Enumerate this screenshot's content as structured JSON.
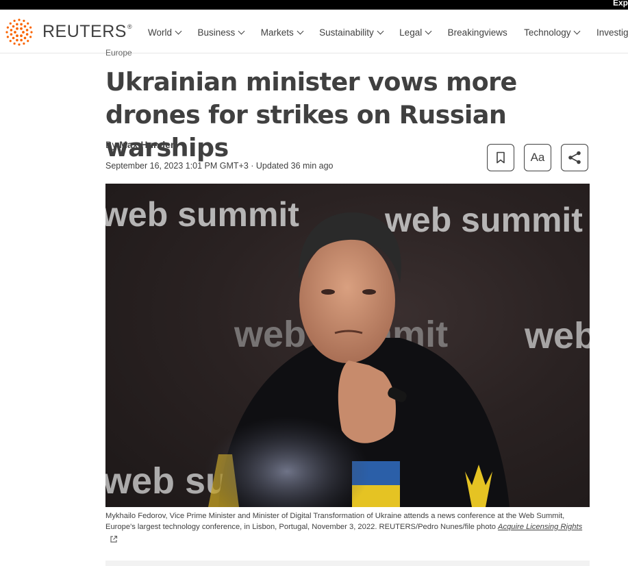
{
  "topbar": {
    "corner_text": "Exp"
  },
  "brand": {
    "name": "REUTERS",
    "mark": "®",
    "color": "#fa6400"
  },
  "nav": {
    "items": [
      {
        "label": "World",
        "dropdown": true
      },
      {
        "label": "Business",
        "dropdown": true
      },
      {
        "label": "Markets",
        "dropdown": true
      },
      {
        "label": "Sustainability",
        "dropdown": true
      },
      {
        "label": "Legal",
        "dropdown": true
      },
      {
        "label": "Breakingviews",
        "dropdown": false
      },
      {
        "label": "Technology",
        "dropdown": true
      },
      {
        "label": "Investigations",
        "dropdown": false
      }
    ]
  },
  "article": {
    "section": "Europe",
    "headline": "Ukrainian minister vows more drones for strikes on Russian warships",
    "byline_prefix": "By",
    "author": "Max Hunder",
    "dateline": "September 16, 2023 1:01 PM GMT+3 · Updated 36 min ago",
    "tools": {
      "font_label": "Aa",
      "save_icon": "bookmark-icon",
      "share_icon": "share-icon"
    },
    "photo": {
      "backdrop_text_top": "web summit",
      "backdrop_text_side": "web summit"
    },
    "caption": "Mykhailo Fedorov, Vice Prime Minister and Minister of Digital Transformation of Ukraine attends a news conference at the Web Summit, Europe's largest technology conference, in Lisbon, Portugal, November 3, 2022. REUTERS/Pedro Nunes/file photo",
    "licensing_link": "Acquire Licensing Rights"
  }
}
